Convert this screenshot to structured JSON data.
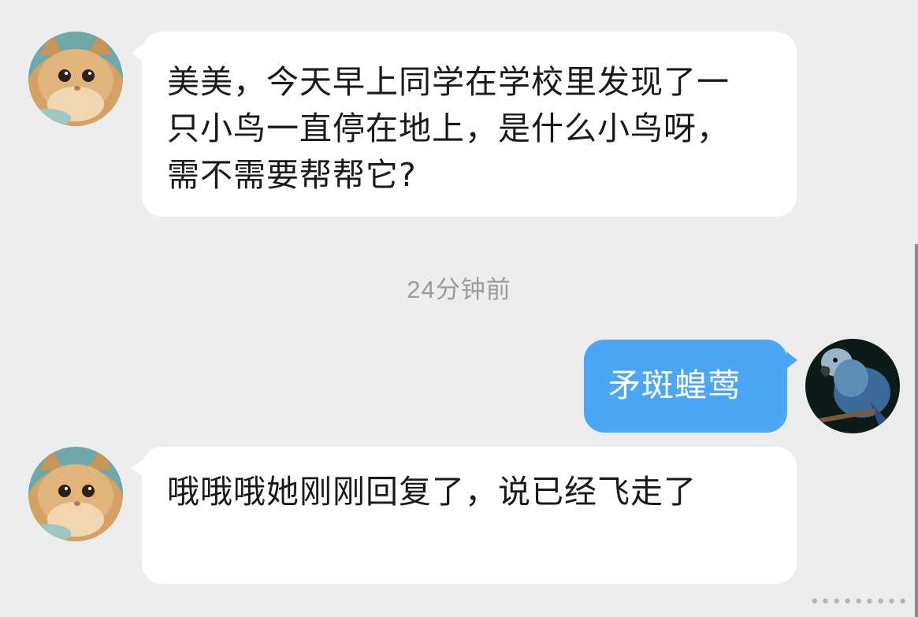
{
  "messages": [
    {
      "sender": "cat-avatar",
      "direction": "incoming",
      "text": "美美，今天早上同学在学校里发现了一只小鸟一直停在地上，是什么小鸟呀，需不需要帮帮它?"
    },
    {
      "sender": "parrot-avatar",
      "direction": "outgoing",
      "text": "矛斑蝗莺"
    },
    {
      "sender": "cat-avatar",
      "direction": "incoming",
      "text": "哦哦哦她刚刚回复了，说已经飞走了"
    }
  ],
  "timestamp": "24分钟前",
  "colors": {
    "background": "#ededed",
    "incoming_bubble": "#ffffff",
    "outgoing_bubble": "#4ba6f5",
    "timestamp_text": "#9b9b9b"
  },
  "icons": {
    "incoming_avatar": "cat-avatar",
    "outgoing_avatar": "parrot-avatar",
    "more": "more-dots-icon"
  }
}
